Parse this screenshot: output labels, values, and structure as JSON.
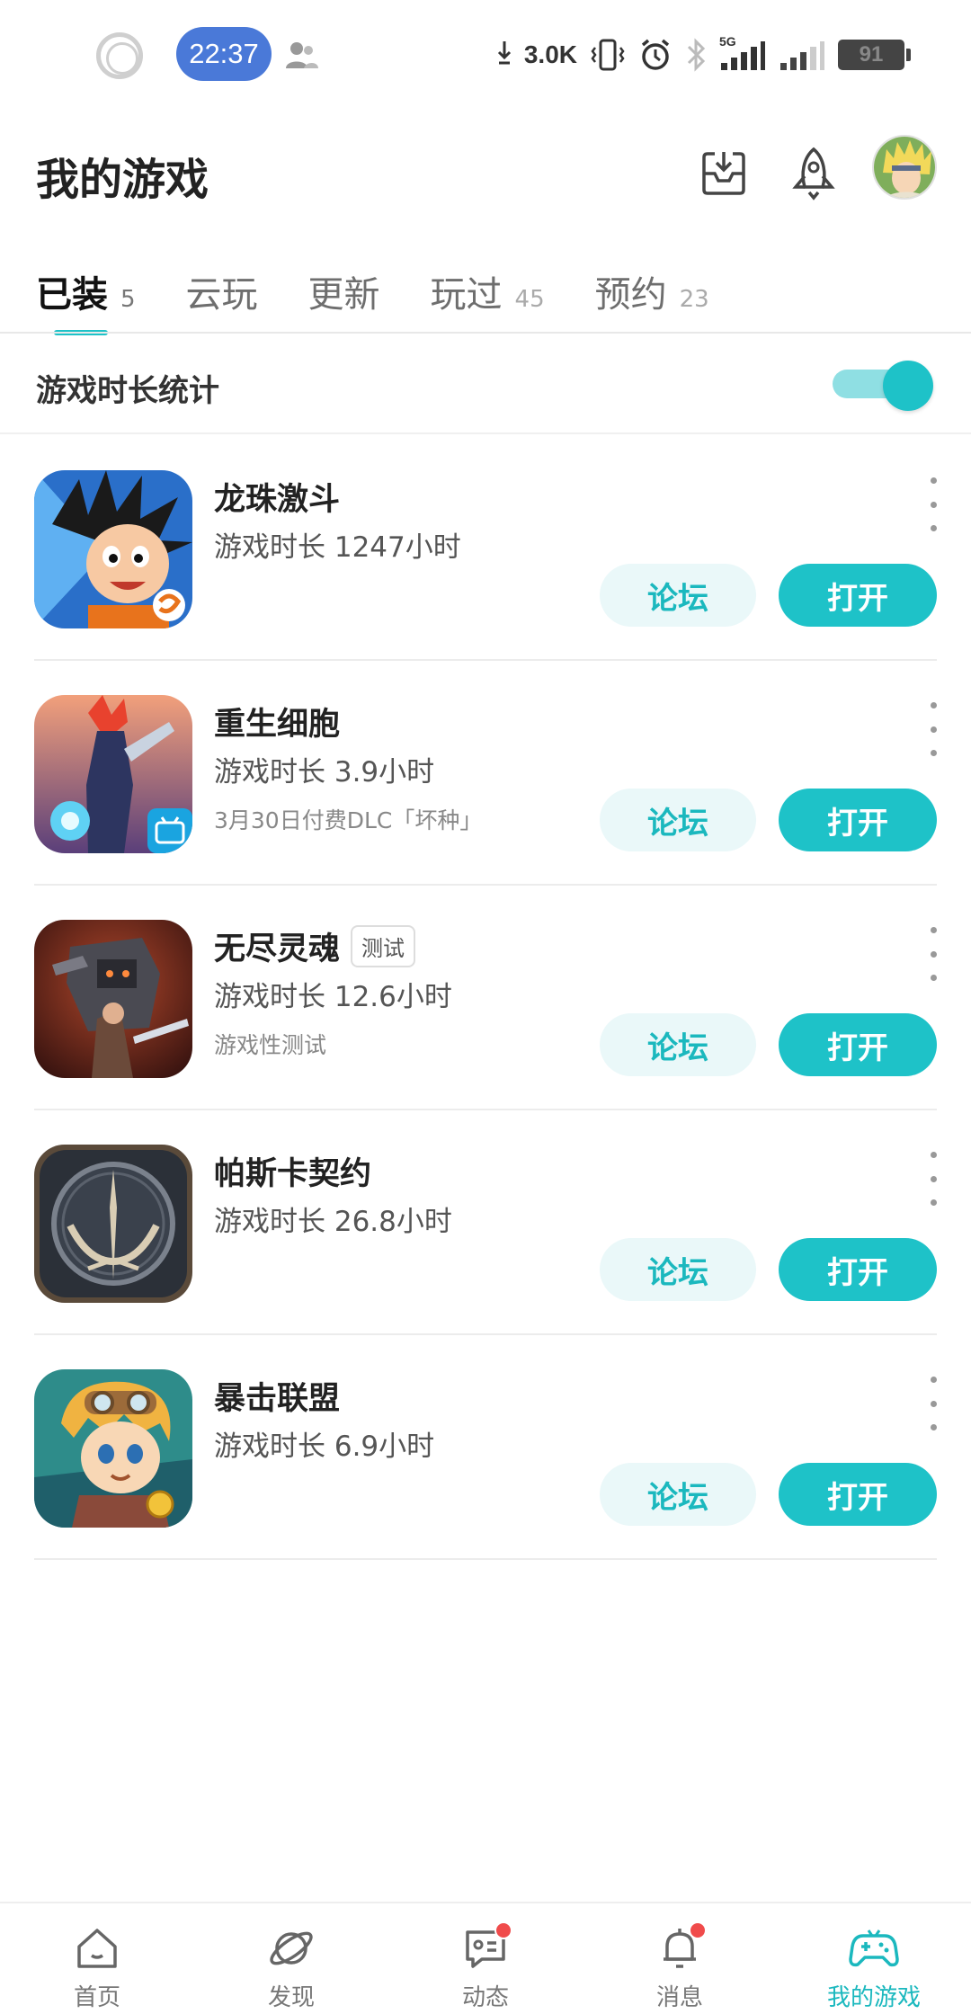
{
  "status_bar": {
    "time": "22:37",
    "net_speed": "3.0K",
    "network_type": "5G",
    "battery": "91"
  },
  "header": {
    "title": "我的游戏"
  },
  "tabs": [
    {
      "label": "已装",
      "count": "5",
      "active": true
    },
    {
      "label": "云玩",
      "count": ""
    },
    {
      "label": "更新",
      "count": ""
    },
    {
      "label": "玩过",
      "count": "45"
    },
    {
      "label": "预约",
      "count": "23"
    }
  ],
  "stats_toggle": {
    "label": "游戏时长统计",
    "on": true
  },
  "games": [
    {
      "name": "龙珠激斗",
      "tag": "",
      "time": "游戏时长 1247小时",
      "sub": "",
      "forum_label": "论坛",
      "open_label": "打开"
    },
    {
      "name": "重生细胞",
      "tag": "",
      "time": "游戏时长 3.9小时",
      "sub": "3月30日付费DLC「坏种」",
      "forum_label": "论坛",
      "open_label": "打开"
    },
    {
      "name": "无尽灵魂",
      "tag": "测试",
      "time": "游戏时长 12.6小时",
      "sub": "游戏性测试",
      "forum_label": "论坛",
      "open_label": "打开"
    },
    {
      "name": "帕斯卡契约",
      "tag": "",
      "time": "游戏时长 26.8小时",
      "sub": "",
      "forum_label": "论坛",
      "open_label": "打开"
    },
    {
      "name": "暴击联盟",
      "tag": "",
      "time": "游戏时长 6.9小时",
      "sub": "",
      "forum_label": "论坛",
      "open_label": "打开"
    }
  ],
  "bottom_nav": [
    {
      "label": "首页",
      "icon": "home-icon"
    },
    {
      "label": "发现",
      "icon": "planet-icon"
    },
    {
      "label": "动态",
      "icon": "message-card-icon",
      "badge": true
    },
    {
      "label": "消息",
      "icon": "bell-icon",
      "badge": true
    },
    {
      "label": "我的游戏",
      "icon": "gamepad-icon",
      "active": true
    }
  ],
  "colors": {
    "accent": "#1ec2c8",
    "accent_light": "#eaf8f9",
    "time_pill": "#4a79d8",
    "badge": "#f04b4b"
  }
}
